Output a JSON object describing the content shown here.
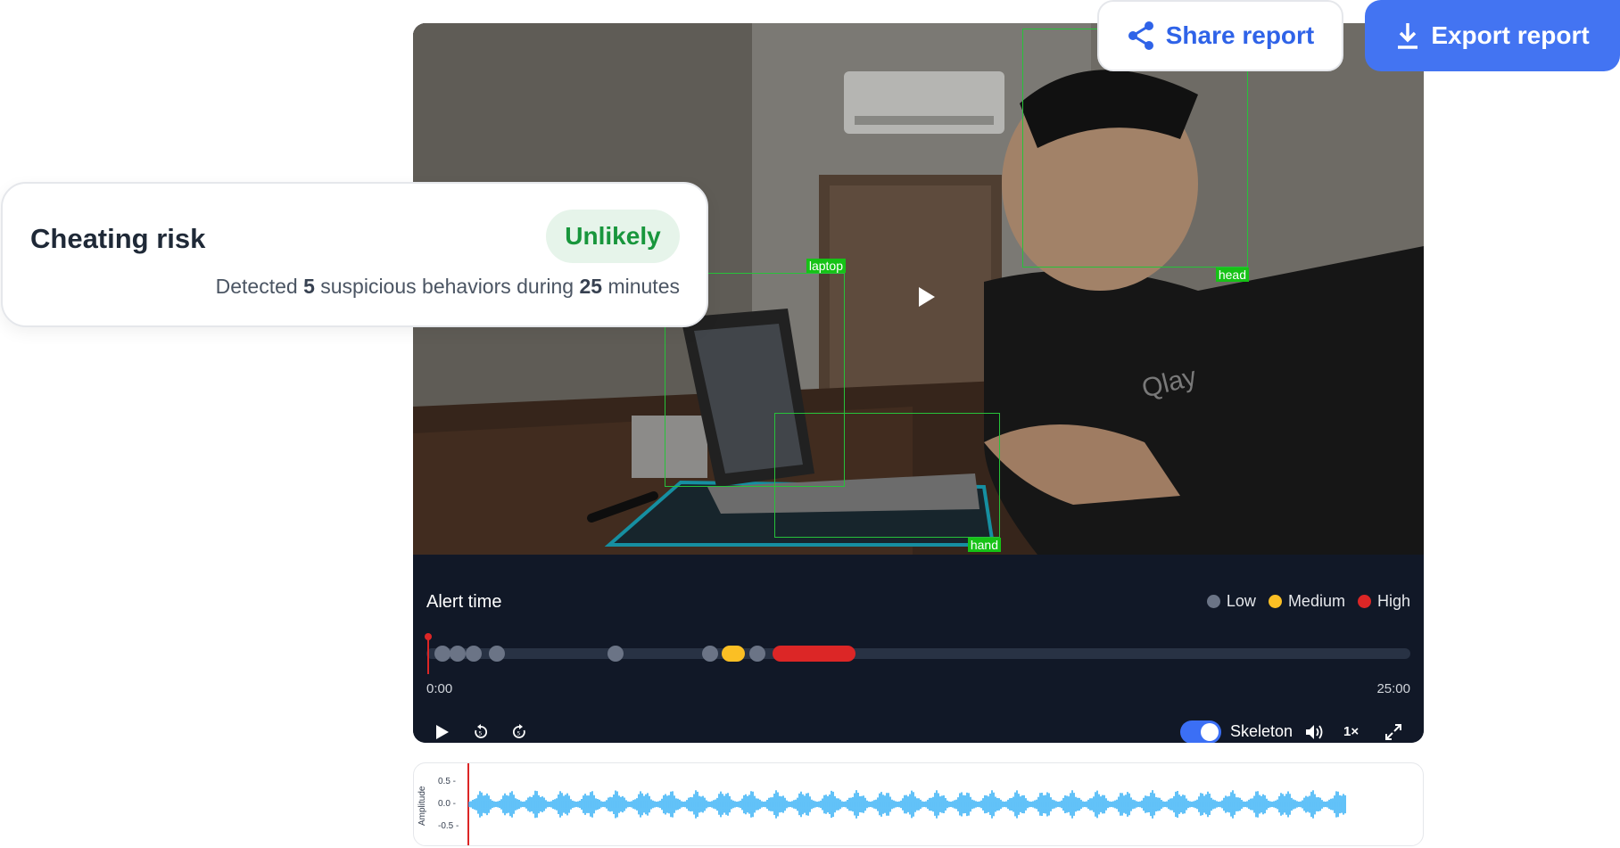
{
  "header_actions": {
    "share_label": "Share report",
    "export_label": "Export report"
  },
  "risk": {
    "title": "Cheating risk",
    "badge": "Unlikely",
    "detail_prefix": "Detected",
    "count": "5",
    "detail_middle": "suspicious behaviors during",
    "duration": "25",
    "detail_suffix": "minutes"
  },
  "detections": [
    {
      "label": "laptop"
    },
    {
      "label": "head"
    },
    {
      "label": "hand"
    }
  ],
  "alert_panel": {
    "title": "Alert time",
    "legend": [
      {
        "label": "Low",
        "color": "#6b7486"
      },
      {
        "label": "Medium",
        "color": "#fbbf24"
      },
      {
        "label": "High",
        "color": "#dc2626"
      }
    ],
    "time_start": "0:00",
    "time_end": "25:00",
    "alerts": [
      {
        "level": "low",
        "start_min": 0.4
      },
      {
        "level": "low",
        "start_min": 0.8
      },
      {
        "level": "low",
        "start_min": 1.2
      },
      {
        "level": "low",
        "start_min": 1.8
      },
      {
        "level": "low",
        "start_min": 4.8
      },
      {
        "level": "low",
        "start_min": 7.2
      },
      {
        "level": "medium",
        "start_min": 7.5,
        "end_min": 8.1
      },
      {
        "level": "low",
        "start_min": 8.4
      },
      {
        "level": "high",
        "start_min": 8.8,
        "end_min": 10.9
      }
    ],
    "playback_position_min": 0
  },
  "controls": {
    "skeleton_label": "Skeleton",
    "skeleton_enabled": true,
    "speed_label": "1×",
    "icons": [
      "play-icon",
      "rewind-icon",
      "forward-icon",
      "volume-icon",
      "fullscreen-icon"
    ]
  },
  "waveform": {
    "ylabel": "Amplitude",
    "ticks": [
      "0.5 -",
      "0.0 -",
      "-0.5 -"
    ],
    "color": "#1ea7f5"
  },
  "colors": {
    "accent": "#4374f2",
    "success": "#18963c",
    "detection_box": "#27c23a"
  }
}
